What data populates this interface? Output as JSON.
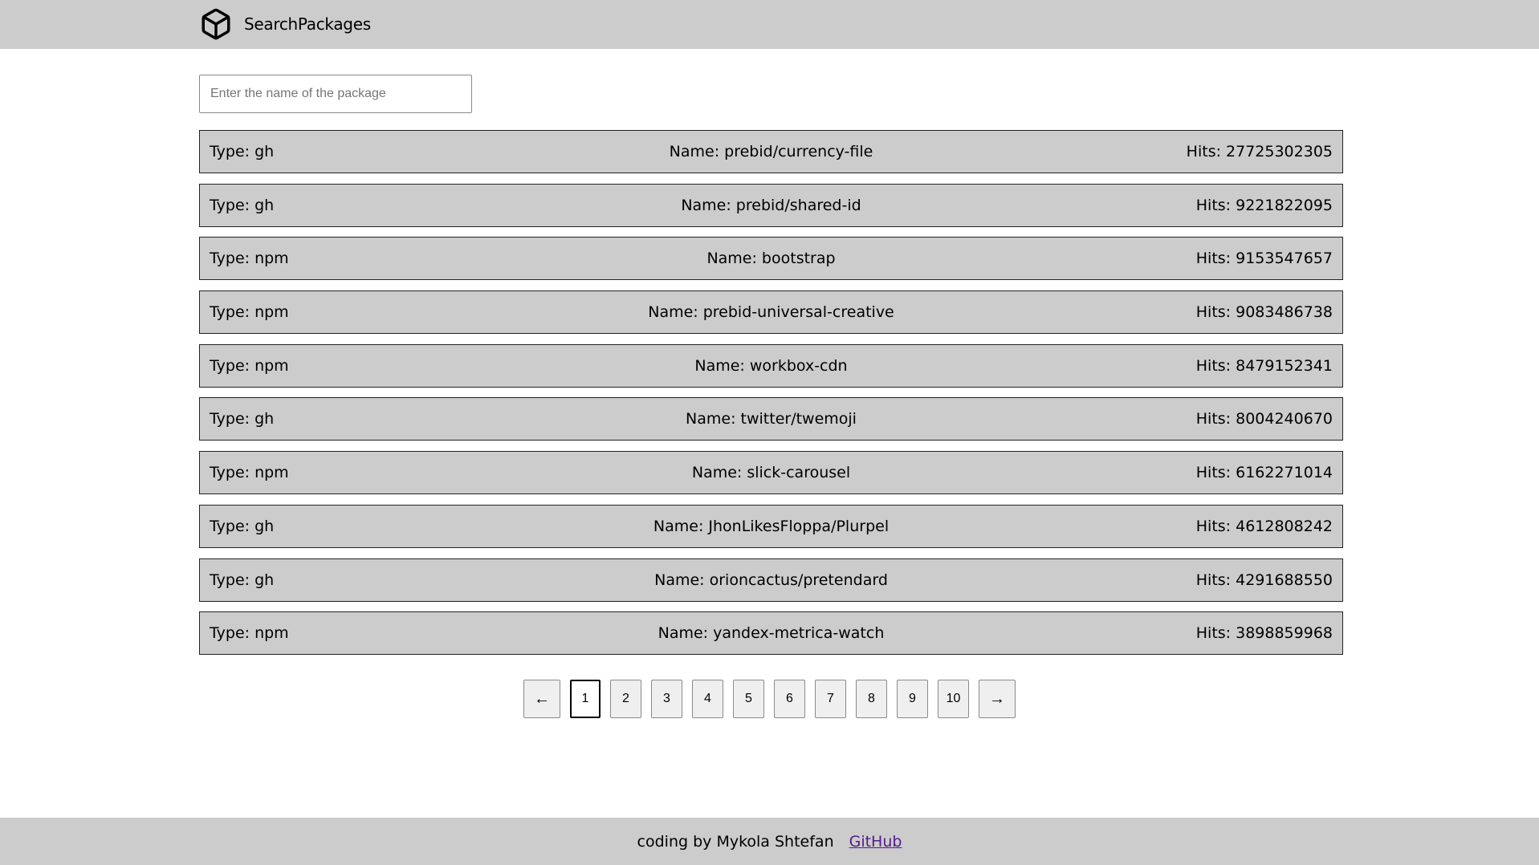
{
  "header": {
    "logo_icon": "cube-icon",
    "title": "SearchPackages"
  },
  "search": {
    "placeholder": "Enter the name of the package",
    "value": ""
  },
  "results": [
    {
      "type": "Type: gh",
      "name": "Name: prebid/currency-file",
      "hits": "Hits: 27725302305"
    },
    {
      "type": "Type: gh",
      "name": "Name: prebid/shared-id",
      "hits": "Hits: 9221822095"
    },
    {
      "type": "Type: npm",
      "name": "Name: bootstrap",
      "hits": "Hits: 9153547657"
    },
    {
      "type": "Type: npm",
      "name": "Name: prebid-universal-creative",
      "hits": "Hits: 9083486738"
    },
    {
      "type": "Type: npm",
      "name": "Name: workbox-cdn",
      "hits": "Hits: 8479152341"
    },
    {
      "type": "Type: gh",
      "name": "Name: twitter/twemoji",
      "hits": "Hits: 8004240670"
    },
    {
      "type": "Type: npm",
      "name": "Name: slick-carousel",
      "hits": "Hits: 6162271014"
    },
    {
      "type": "Type: gh",
      "name": "Name: JhonLikesFloppa/Plurpel",
      "hits": "Hits: 4612808242"
    },
    {
      "type": "Type: gh",
      "name": "Name: orioncactus/pretendard",
      "hits": "Hits: 4291688550"
    },
    {
      "type": "Type: npm",
      "name": "Name: yandex-metrica-watch",
      "hits": "Hits: 3898859968"
    }
  ],
  "pagination": {
    "prev_label": "←",
    "next_label": "→",
    "pages": [
      "1",
      "2",
      "3",
      "4",
      "5",
      "6",
      "7",
      "8",
      "9",
      "10"
    ],
    "current": "1"
  },
  "footer": {
    "credit": "coding by Mykola Shtefan",
    "link_label": "GitHub"
  },
  "colors": {
    "bar_background": "#cccccc",
    "link_visited": "#551a8b"
  }
}
